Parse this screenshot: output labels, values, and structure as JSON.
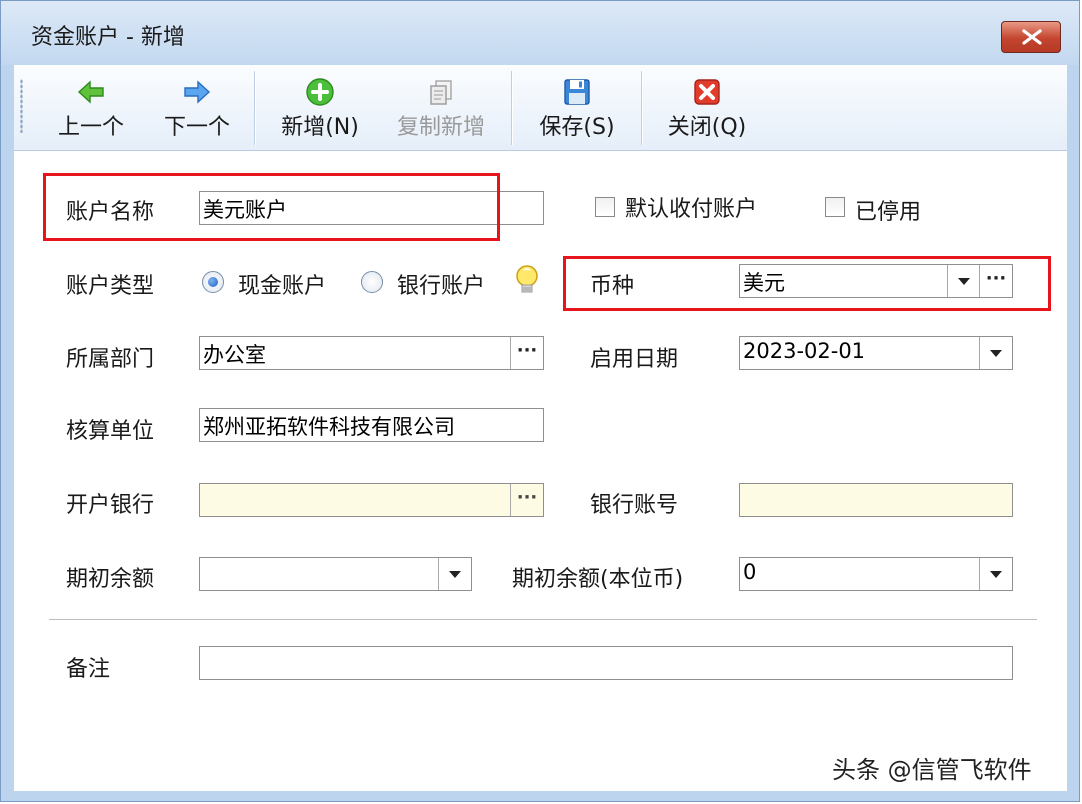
{
  "window": {
    "title": "资金账户 - 新增",
    "close_icon": "close-x"
  },
  "toolbar": {
    "prev": {
      "label": "上一个",
      "icon": "arrow-left-green"
    },
    "next": {
      "label": "下一个",
      "icon": "arrow-right-blue"
    },
    "new": {
      "label": "新增(N)",
      "icon": "plus-circle-green"
    },
    "copy_new": {
      "label": "复制新增",
      "icon": "copy-doc-gray",
      "disabled": true
    },
    "save": {
      "label": "保存(S)",
      "icon": "floppy-disk-blue"
    },
    "close": {
      "label": "关闭(Q)",
      "icon": "close-red-x"
    }
  },
  "form": {
    "account_name": {
      "label": "账户名称",
      "value": "美元账户"
    },
    "default_payment": {
      "label": "默认收付账户",
      "checked": false
    },
    "disabled": {
      "label": "已停用",
      "checked": false
    },
    "account_type": {
      "label": "账户类型",
      "options": [
        "现金账户",
        "银行账户"
      ],
      "selected": "现金账户",
      "hint_icon": "lightbulb"
    },
    "currency": {
      "label": "币种",
      "value": "美元"
    },
    "department": {
      "label": "所属部门",
      "value": "办公室"
    },
    "start_date": {
      "label": "启用日期",
      "value": "2023-02-01"
    },
    "accounting_unit": {
      "label": "核算单位",
      "value": "郑州亚拓软件科技有限公司"
    },
    "bank": {
      "label": "开户银行",
      "value": ""
    },
    "bank_account": {
      "label": "银行账号",
      "value": ""
    },
    "opening_balance": {
      "label": "期初余额",
      "value": ""
    },
    "opening_balance_base": {
      "label": "期初余额(本位币)",
      "value": "0"
    },
    "remark": {
      "label": "备注",
      "value": ""
    }
  },
  "highlight_color": "#e8141b",
  "watermark": "头条 @信管飞软件"
}
